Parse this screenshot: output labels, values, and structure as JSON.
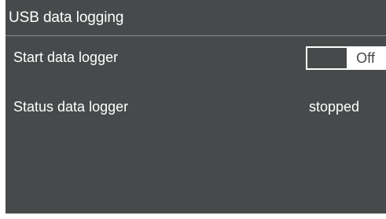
{
  "header": {
    "title": "USB data logging"
  },
  "settings": {
    "start_logger": {
      "label": "Start data logger",
      "toggle_state": "Off"
    },
    "status_logger": {
      "label": "Status data logger",
      "value": "stopped"
    }
  },
  "colors": {
    "background": "#474a4b",
    "text": "#ffffff",
    "divider": "#8a8d8e",
    "toggle_track": "#ffffff",
    "toggle_text": "#444648"
  }
}
